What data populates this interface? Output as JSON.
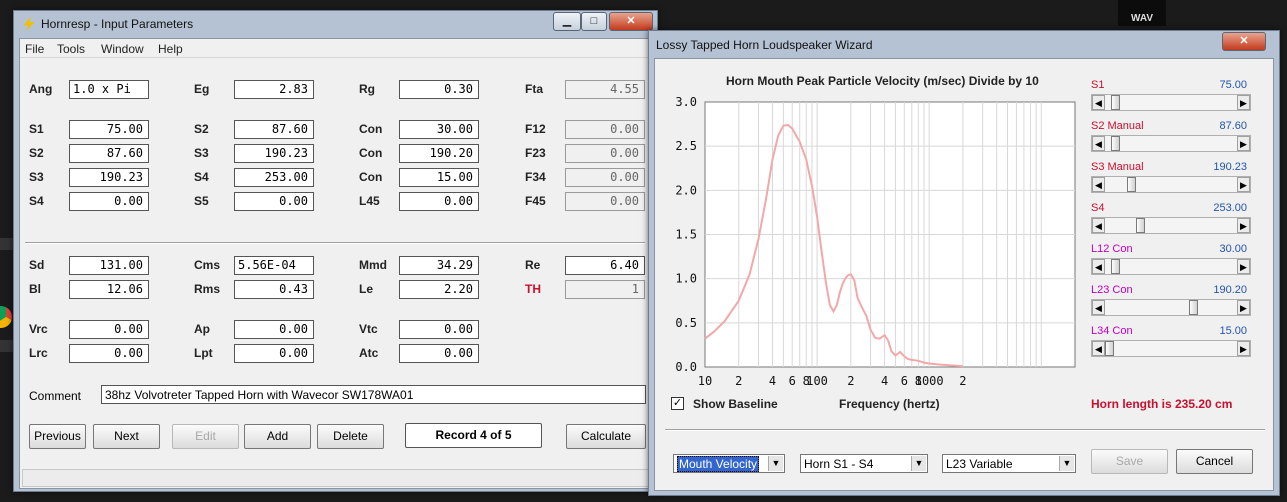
{
  "main_window": {
    "title": "Hornresp - Input Parameters",
    "menu": [
      "File",
      "Tools",
      "Window",
      "Help"
    ],
    "params": [
      {
        "label": "Ang",
        "value": "1.0 x Pi",
        "align": "left"
      },
      {
        "label": "Eg",
        "value": "2.83"
      },
      {
        "label": "Rg",
        "value": "0.30"
      },
      {
        "label": "Fta",
        "value": "4.55",
        "readonly": true
      },
      {
        "label": "S1",
        "value": "75.00"
      },
      {
        "label": "S2",
        "value": "87.60"
      },
      {
        "label": "Con",
        "value": "30.00"
      },
      {
        "label": "F12",
        "value": "0.00",
        "readonly": true
      },
      {
        "label": "S2",
        "value": "87.60"
      },
      {
        "label": "S3",
        "value": "190.23"
      },
      {
        "label": "Con",
        "value": "190.20"
      },
      {
        "label": "F23",
        "value": "0.00",
        "readonly": true
      },
      {
        "label": "S3",
        "value": "190.23"
      },
      {
        "label": "S4",
        "value": "253.00"
      },
      {
        "label": "Con",
        "value": "15.00"
      },
      {
        "label": "F34",
        "value": "0.00",
        "readonly": true
      },
      {
        "label": "S4",
        "value": "0.00"
      },
      {
        "label": "S5",
        "value": "0.00"
      },
      {
        "label": "L45",
        "value": "0.00"
      },
      {
        "label": "F45",
        "value": "0.00",
        "readonly": true
      },
      {
        "label": "Sd",
        "value": "131.00"
      },
      {
        "label": "Cms",
        "value": "5.56E-04",
        "align": "left"
      },
      {
        "label": "Mmd",
        "value": "34.29"
      },
      {
        "label": "Re",
        "value": "6.40"
      },
      {
        "label": "Bl",
        "value": "12.06"
      },
      {
        "label": "Rms",
        "value": "0.43"
      },
      {
        "label": "Le",
        "value": "2.20"
      },
      {
        "label": "TH",
        "value": "1",
        "readonly": true,
        "red": true
      },
      {
        "label": "Vrc",
        "value": "0.00"
      },
      {
        "label": "Ap",
        "value": "0.00"
      },
      {
        "label": "Vtc",
        "value": "0.00"
      },
      {
        "label": "Lrc",
        "value": "0.00"
      },
      {
        "label": "Lpt",
        "value": "0.00"
      },
      {
        "label": "Atc",
        "value": "0.00"
      }
    ],
    "comment_label": "Comment",
    "comment_value": "38hz Volvotreter Tapped Horn with Wavecor SW178WA01",
    "buttons": {
      "previous": "Previous",
      "next": "Next",
      "edit": "Edit",
      "add": "Add",
      "delete": "Delete",
      "record": "Record 4 of 5",
      "calculate": "Calculate"
    }
  },
  "wizard_window": {
    "title": "Lossy Tapped Horn Loudspeaker Wizard",
    "chart_title": "Horn Mouth Peak Particle Velocity (m/sec)     Divide by 10",
    "xlabel": "Frequency (hertz)",
    "show_baseline_label": "Show Baseline",
    "show_baseline_checked": true,
    "horn_length": "Horn length is 235.20 cm",
    "sliders": [
      {
        "label": "S1",
        "value": "75.00",
        "color": "#c8102e",
        "pos": 0.05
      },
      {
        "label": "S2  Manual",
        "value": "87.60",
        "color": "#c8102e",
        "pos": 0.05
      },
      {
        "label": "S3  Manual",
        "value": "190.23",
        "color": "#c8102e",
        "pos": 0.18
      },
      {
        "label": "S4",
        "value": "253.00",
        "color": "#c8102e",
        "pos": 0.25
      },
      {
        "label": "L12  Con",
        "value": "30.00",
        "color": "#c000c0",
        "pos": 0.05
      },
      {
        "label": "L23  Con",
        "value": "190.20",
        "color": "#c000c0",
        "pos": 0.68
      },
      {
        "label": "L34  Con",
        "value": "15.00",
        "color": "#c000c0",
        "pos": 0.0
      }
    ],
    "dropdowns": [
      "Mouth Velocity",
      "Horn S1 - S4",
      "L23 Variable"
    ],
    "buttons": {
      "save": "Save",
      "cancel": "Cancel"
    }
  },
  "desktop": {
    "badge": "WAV"
  },
  "chart_data": {
    "type": "line",
    "title": "Horn Mouth Peak Particle Velocity (m/sec)     Divide by 10",
    "xlabel": "Frequency (hertz)",
    "ylabel": "",
    "xscale": "log",
    "xlim": [
      10,
      20000
    ],
    "ylim": [
      0,
      3.0
    ],
    "yticks": [
      "0.0",
      "0.5",
      "1.0",
      "1.5",
      "2.0",
      "2.5",
      "3.0"
    ],
    "xticks": [
      {
        "v": 10,
        "t": "10"
      },
      {
        "v": 20,
        "t": "2"
      },
      {
        "v": 40,
        "t": "4"
      },
      {
        "v": 60,
        "t": "6"
      },
      {
        "v": 80,
        "t": "8"
      },
      {
        "v": 100,
        "t": "100"
      },
      {
        "v": 200,
        "t": "2"
      },
      {
        "v": 400,
        "t": "4"
      },
      {
        "v": 600,
        "t": "6"
      },
      {
        "v": 800,
        "t": "8"
      },
      {
        "v": 1000,
        "t": "1000"
      },
      {
        "v": 2000,
        "t": "2"
      }
    ],
    "grid": true,
    "series": [
      {
        "color": "#f2a8a8",
        "x": [
          10,
          12,
          15,
          20,
          25,
          30,
          35,
          40,
          45,
          50,
          55,
          60,
          70,
          80,
          90,
          100,
          110,
          120,
          130,
          140,
          150,
          160,
          170,
          180,
          190,
          200,
          215,
          230,
          250,
          275,
          300,
          330,
          360,
          400,
          430,
          460,
          500,
          550,
          600,
          650,
          700,
          800,
          900,
          1000,
          1200,
          1500,
          2000
        ],
        "y": [
          0.32,
          0.4,
          0.52,
          0.75,
          1.05,
          1.45,
          1.9,
          2.35,
          2.62,
          2.73,
          2.74,
          2.7,
          2.55,
          2.35,
          2.05,
          1.7,
          1.3,
          0.95,
          0.7,
          0.63,
          0.7,
          0.85,
          0.95,
          1.01,
          1.04,
          1.05,
          0.98,
          0.78,
          0.68,
          0.58,
          0.42,
          0.33,
          0.32,
          0.36,
          0.3,
          0.18,
          0.13,
          0.17,
          0.12,
          0.09,
          0.08,
          0.07,
          0.05,
          0.04,
          0.03,
          0.02,
          0.01
        ]
      }
    ]
  }
}
